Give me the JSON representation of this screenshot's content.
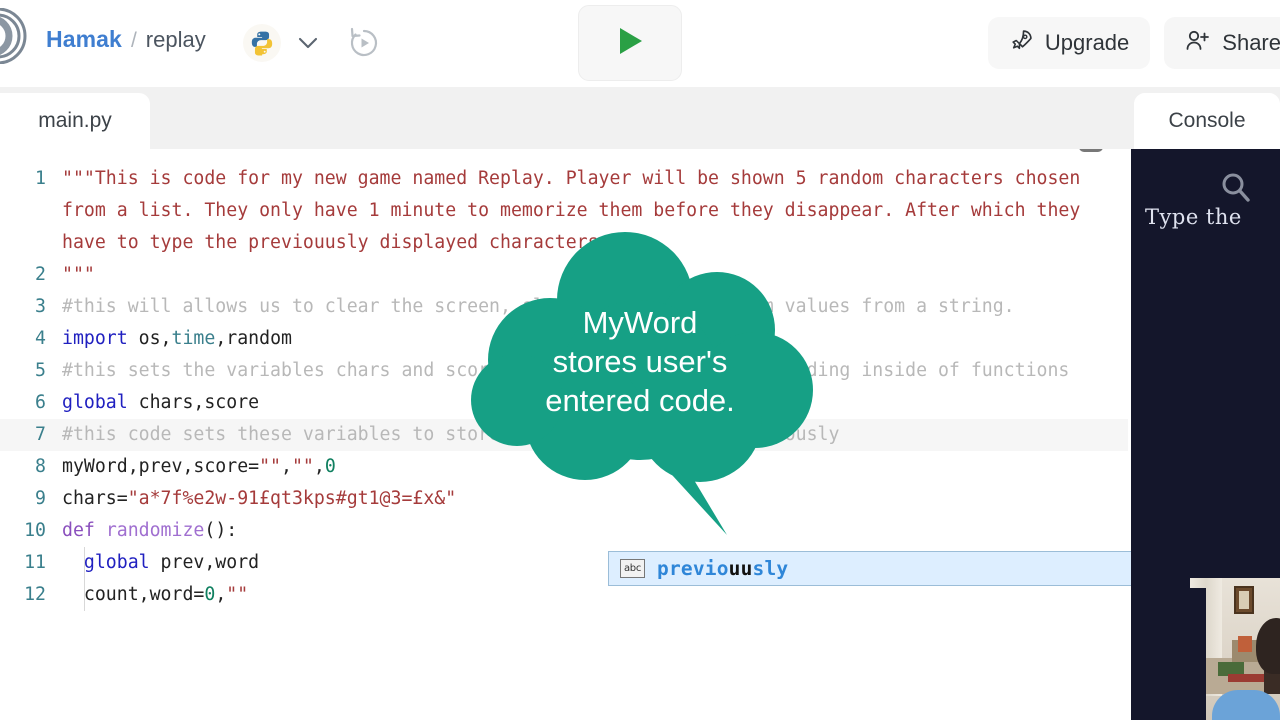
{
  "header": {
    "owner": "Hamak",
    "separator": "/",
    "project": "replay",
    "language_icon": "python-icon",
    "dropdown_icon": "chevron-down-icon",
    "history_icon": "history-replay-icon",
    "run_icon": "play-icon",
    "run_label": "",
    "upgrade_label": "Upgrade",
    "upgrade_icon": "rocket-icon",
    "share_label": "Share",
    "share_icon": "person-plus-icon",
    "logo_icon": "replit-logo-icon",
    "accent_blue": "#3f7ed0",
    "run_green": "#2aa045"
  },
  "editor": {
    "file_tab": "main.py",
    "format_icon": "format-lines-icon",
    "scrollbar": "vertical-scrollbar",
    "lines": [
      {
        "n": "1",
        "active": false,
        "indent": false,
        "segments": [
          {
            "cls": "tok-s",
            "t": "\"\"\"This is code for my new game named Replay. Player will be shown 5 random characters chosen from a list. They only have 1 minute to memorize them before they disappear. After which they have to type the previouusly displayed characters."
          }
        ]
      },
      {
        "n": "2",
        "active": false,
        "indent": false,
        "segments": [
          {
            "cls": "tok-s",
            "t": "\"\"\""
          }
        ]
      },
      {
        "n": "3",
        "active": false,
        "indent": false,
        "segments": [
          {
            "cls": "tok-c",
            "t": "#this will allows us to clear the screen, sleep and select random values from a string."
          }
        ]
      },
      {
        "n": "4",
        "active": false,
        "indent": false,
        "segments": [
          {
            "cls": "tok-k",
            "t": "import"
          },
          {
            "cls": "tok-p",
            "t": " os,"
          },
          {
            "cls": "tok-m",
            "t": "time"
          },
          {
            "cls": "tok-p",
            "t": ",random"
          }
        ]
      },
      {
        "n": "5",
        "active": false,
        "indent": false,
        "segments": [
          {
            "cls": "tok-c",
            "t": "#this sets the variables chars and score to be usable anywhere including inside of functions"
          }
        ]
      },
      {
        "n": "6",
        "active": false,
        "indent": false,
        "segments": [
          {
            "cls": "tok-k",
            "t": "global"
          },
          {
            "cls": "tok-p",
            "t": " chars,score"
          }
        ]
      },
      {
        "n": "7",
        "active": true,
        "indent": false,
        "segments": [
          {
            "cls": "tok-c",
            "t": "#this code sets these variables to store the formed code, the prevously"
          }
        ]
      },
      {
        "n": "8",
        "active": false,
        "indent": false,
        "segments": [
          {
            "cls": "tok-p",
            "t": "myWord,prev,score="
          },
          {
            "cls": "tok-s",
            "t": "\"\""
          },
          {
            "cls": "tok-p",
            "t": ","
          },
          {
            "cls": "tok-s",
            "t": "\"\""
          },
          {
            "cls": "tok-p",
            "t": ","
          },
          {
            "cls": "tok-n",
            "t": "0"
          }
        ]
      },
      {
        "n": "9",
        "active": false,
        "indent": false,
        "segments": [
          {
            "cls": "tok-p",
            "t": "chars="
          },
          {
            "cls": "tok-s",
            "t": "\"a*7f%e2w-91£qt3kps#gt1@3=£x&\""
          }
        ]
      },
      {
        "n": "10",
        "active": false,
        "indent": false,
        "segments": [
          {
            "cls": "tok-d",
            "t": "def"
          },
          {
            "cls": "tok-p",
            "t": " "
          },
          {
            "cls": "tok-f",
            "t": "randomize"
          },
          {
            "cls": "tok-p",
            "t": "():"
          }
        ]
      },
      {
        "n": "11",
        "active": false,
        "indent": true,
        "segments": [
          {
            "cls": "tok-p",
            "t": "  "
          },
          {
            "cls": "tok-k",
            "t": "global"
          },
          {
            "cls": "tok-p",
            "t": " prev,word"
          }
        ]
      },
      {
        "n": "12",
        "active": false,
        "indent": true,
        "segments": [
          {
            "cls": "tok-p",
            "t": "  count,word="
          },
          {
            "cls": "tok-n",
            "t": "0"
          },
          {
            "cls": "tok-p",
            "t": ","
          },
          {
            "cls": "tok-s",
            "t": "\"\""
          }
        ]
      }
    ]
  },
  "autocomplete": {
    "icon_label": "abc",
    "icon_name": "abc-word-icon",
    "word_parts": [
      {
        "t": "previo",
        "hl": true
      },
      {
        "t": "u",
        "hl": false
      },
      {
        "t": "u",
        "hl": false
      },
      {
        "t": "sly",
        "hl": true
      }
    ],
    "full_word": "previouusly"
  },
  "console": {
    "tab_label": "Console",
    "output_text": "Type the",
    "search_icon": "search-magnifier-icon",
    "background": "#14162b"
  },
  "callout": {
    "line1": "MyWord",
    "line2": "stores user's",
    "line3": "entered code.",
    "color": "#16a085"
  },
  "webcam": {
    "name": "webcam-overlay"
  }
}
